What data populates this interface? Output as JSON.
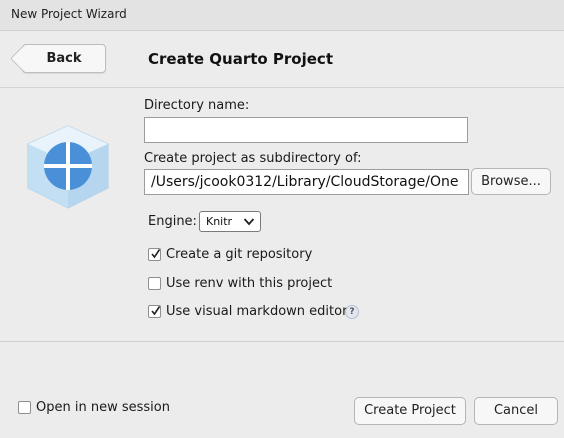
{
  "window": {
    "title": "New Project Wizard"
  },
  "header": {
    "back_label": "Back",
    "title": "Create Quarto Project"
  },
  "form": {
    "directory_label": "Directory name:",
    "directory_value": "",
    "parent_label": "Create project as subdirectory of:",
    "parent_value": "/Users/jcook0312/Library/CloudStorage/One",
    "browse_label": "Browse...",
    "engine_label": "Engine:",
    "engine_value": "Knitr",
    "options": [
      {
        "label": "Create a git repository",
        "checked": true
      },
      {
        "label": "Use renv with this project",
        "checked": false
      },
      {
        "label": "Use visual markdown editor",
        "checked": true
      }
    ],
    "help_glyph": "?"
  },
  "footer": {
    "new_session_label": "Open in new session",
    "new_session_checked": false,
    "create_label": "Create Project",
    "cancel_label": "Cancel"
  },
  "icons": {
    "back": "chevron-left-icon",
    "logo": "quarto-logo-icon",
    "dropdown": "chevron-updown-icon",
    "help": "help-icon",
    "check": "checkmark-icon"
  }
}
